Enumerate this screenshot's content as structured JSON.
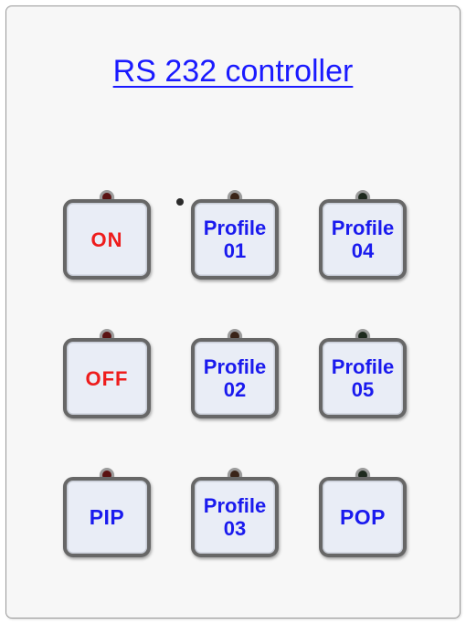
{
  "panel": {
    "title": "RS 232 controller"
  },
  "buttons": [
    {
      "label": "ON",
      "led_color": "#5a1212",
      "text_color": "#ee1c1c"
    },
    {
      "label": "Profile\n01",
      "led_color": "#3a2418",
      "text_color": "#1a1aee"
    },
    {
      "label": "Profile\n04",
      "led_color": "#1e2a1e",
      "text_color": "#1a1aee"
    },
    {
      "label": "OFF",
      "led_color": "#5a1212",
      "text_color": "#ee1c1c"
    },
    {
      "label": "Profile\n02",
      "led_color": "#3a2418",
      "text_color": "#1a1aee"
    },
    {
      "label": "Profile\n05",
      "led_color": "#1e2a1e",
      "text_color": "#1a1aee"
    },
    {
      "label": "PIP",
      "led_color": "#5a1212",
      "text_color": "#1a1aee"
    },
    {
      "label": "Profile\n03",
      "led_color": "#3a2418",
      "text_color": "#1a1aee"
    },
    {
      "label": "POP",
      "led_color": "#1e2a1e",
      "text_color": "#1a1aee"
    }
  ]
}
